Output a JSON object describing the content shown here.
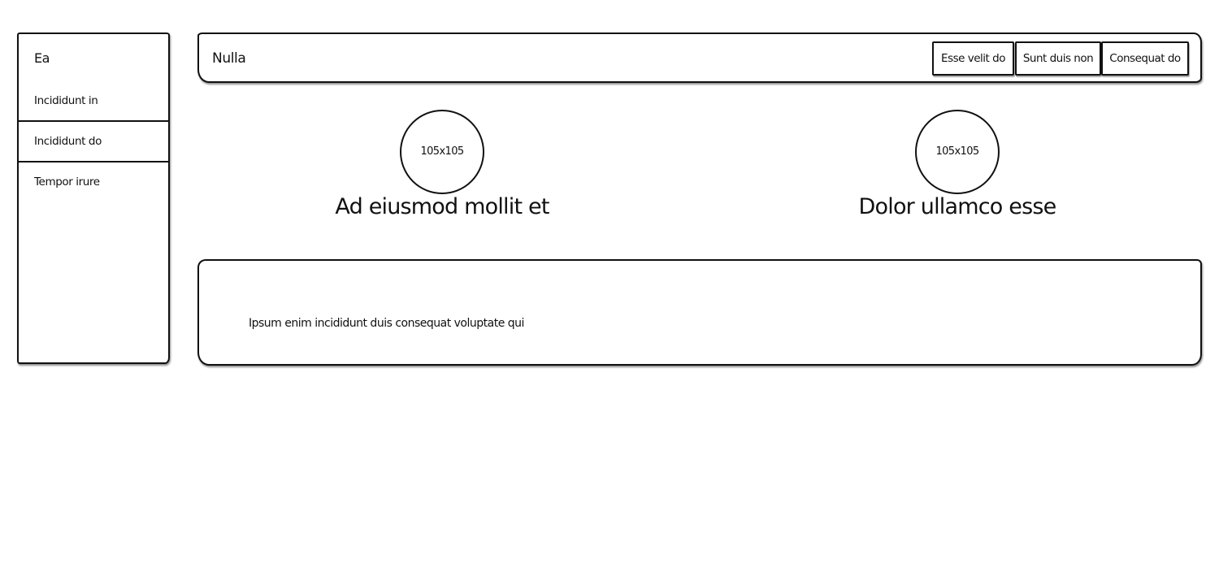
{
  "sidebar": {
    "title": "Ea",
    "items": [
      {
        "label": "Incididunt in"
      },
      {
        "label": "Incididunt do"
      },
      {
        "label": "Tempor irure"
      }
    ]
  },
  "header": {
    "title": "Nulla",
    "buttons": [
      {
        "label": "Esse velit do"
      },
      {
        "label": "Sunt duis non"
      },
      {
        "label": "Consequat do"
      }
    ]
  },
  "cards": [
    {
      "avatar_text": "105x105",
      "name": "Ad eiusmod mollit et"
    },
    {
      "avatar_text": "105x105",
      "name": "Dolor ullamco esse"
    }
  ],
  "content": {
    "text": "Ipsum enim incididunt duis consequat voluptate qui"
  }
}
